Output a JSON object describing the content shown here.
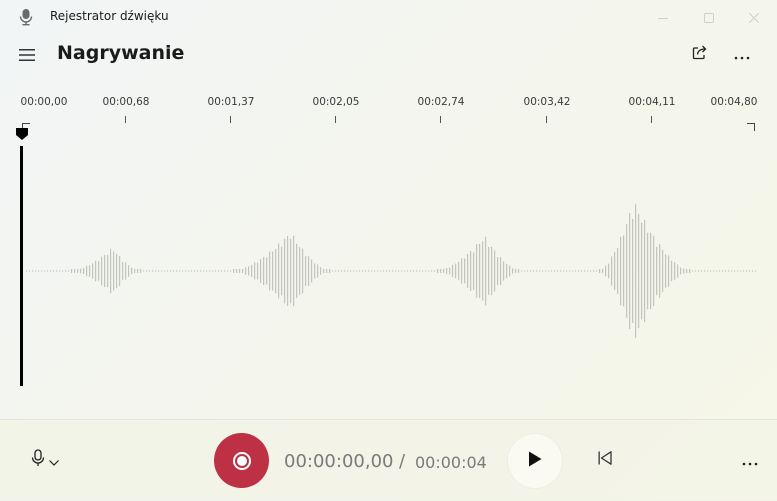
{
  "window": {
    "title": "Rejestrator dźwięku",
    "icon": "microphone-app-icon"
  },
  "header": {
    "title": "Nagrywanie",
    "share_icon": "share-icon",
    "more_icon": "more-icon"
  },
  "timeline": {
    "ticks": [
      "00:00,00",
      "00:00,68",
      "00:01,37",
      "00:02,05",
      "00:02,74",
      "00:03,42",
      "00:04,11",
      "00:04,80"
    ]
  },
  "playback": {
    "current_time": "00:00:00,00",
    "separator": "/",
    "total_time": "00:00:04",
    "playhead_position_seconds": 0
  },
  "colors": {
    "record": "#be3145",
    "waveform": "#c4c4bc",
    "playhead": "#000000"
  }
}
